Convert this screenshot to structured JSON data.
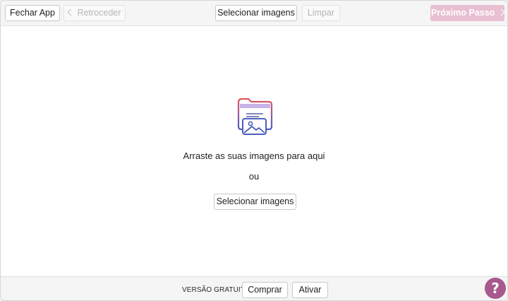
{
  "toolbar": {
    "close_label": "Fechar App",
    "back_label": "Retroceder",
    "select_images_label": "Selecionar imagens",
    "clear_label": "Limpar",
    "next_label": "Próximo Passo"
  },
  "dropzone": {
    "icon": "folder-image-icon",
    "drag_text": "Arraste as suas imagens para aqui",
    "or_text": "ou",
    "select_images_label": "Selecionar imagens"
  },
  "footer": {
    "edition_text": "VERSÃO GRATUITO",
    "buy_label": "Comprar",
    "activate_label": "Ativar"
  },
  "help": {
    "icon": "help-icon",
    "glyph": "?"
  },
  "colors": {
    "accent_pink": "#e9bfd3",
    "help_purple": "#a8588d",
    "icon_red": "#e0575b",
    "icon_blue": "#4b5fc0"
  }
}
